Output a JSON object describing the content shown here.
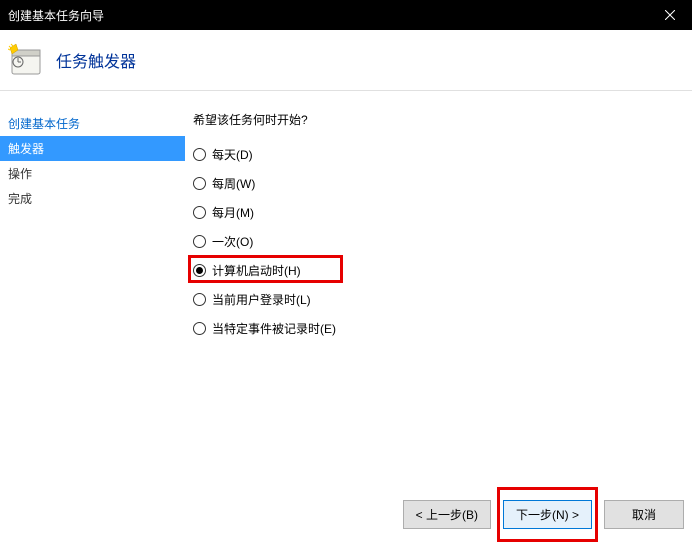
{
  "titlebar": {
    "title": "创建基本任务向导"
  },
  "header": {
    "title": "任务触发器"
  },
  "sidebar": {
    "items": [
      {
        "label": "创建基本任务",
        "active": false
      },
      {
        "label": "触发器",
        "active": true
      },
      {
        "label": "操作",
        "active": false
      },
      {
        "label": "完成",
        "active": false
      }
    ]
  },
  "main": {
    "question": "希望该任务何时开始?",
    "options": [
      {
        "label": "每天(D)",
        "checked": false
      },
      {
        "label": "每周(W)",
        "checked": false
      },
      {
        "label": "每月(M)",
        "checked": false
      },
      {
        "label": "一次(O)",
        "checked": false
      },
      {
        "label": "计算机启动时(H)",
        "checked": true,
        "highlighted": true
      },
      {
        "label": "当前用户登录时(L)",
        "checked": false
      },
      {
        "label": "当特定事件被记录时(E)",
        "checked": false
      }
    ]
  },
  "footer": {
    "back": "< 上一步(B)",
    "next": "下一步(N) >",
    "cancel": "取消"
  }
}
